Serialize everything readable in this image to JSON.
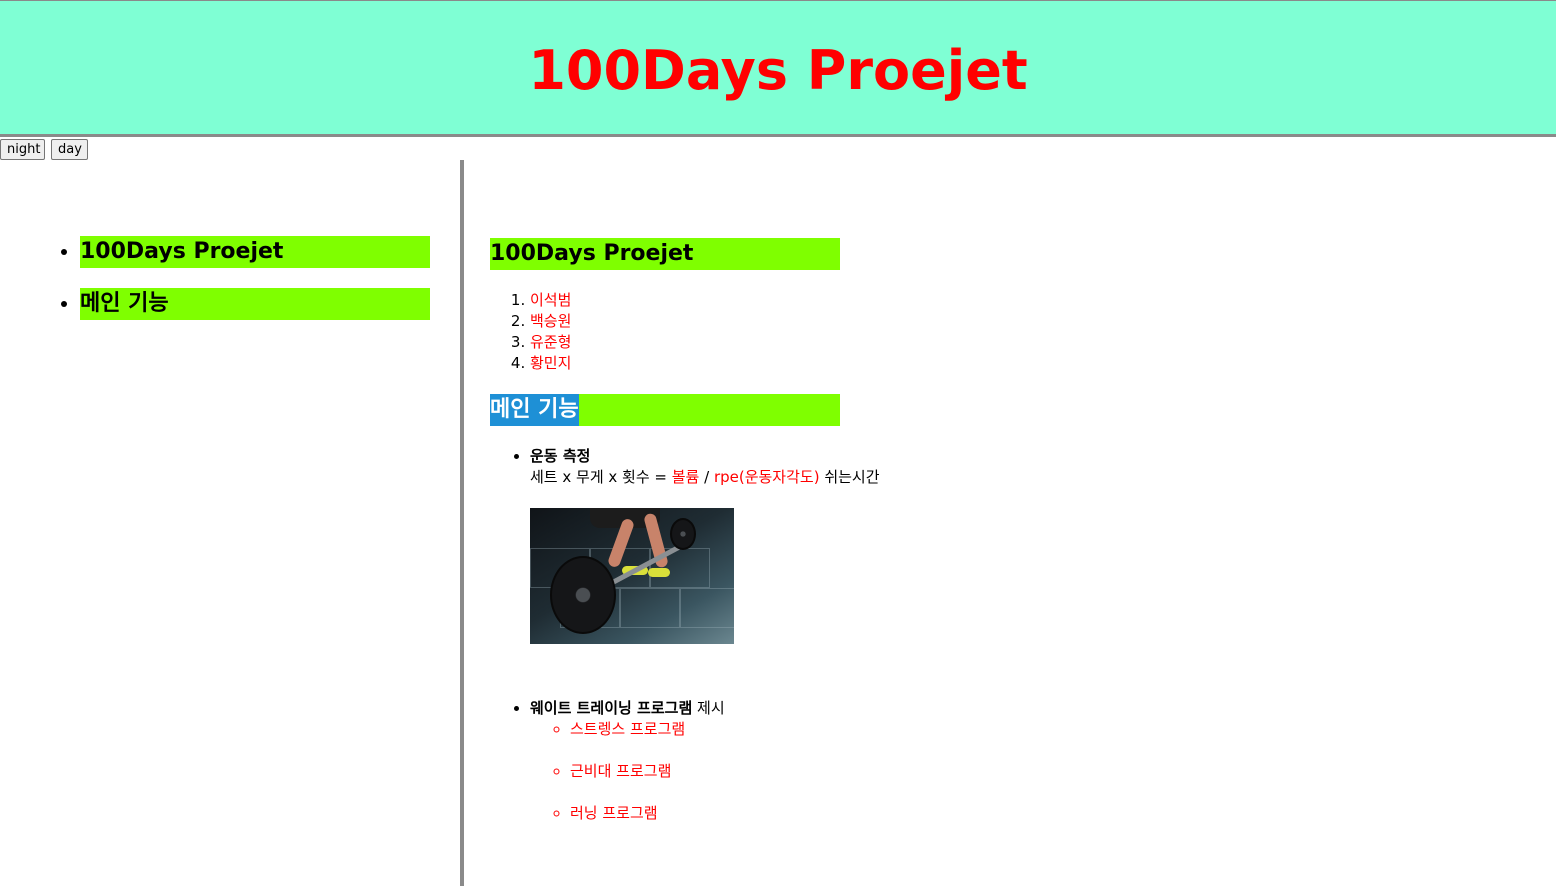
{
  "header": {
    "title": "100Days Proejet"
  },
  "mode_buttons": {
    "night_label": "night",
    "day_label": "day"
  },
  "sidebar": {
    "items": [
      {
        "label": "100Days Proejet"
      },
      {
        "label": "메인 기능"
      }
    ]
  },
  "main": {
    "project_heading": "100Days Proejet",
    "members": [
      "이석범",
      "백승원",
      "유준형",
      "황민지"
    ],
    "main_heading": "메인 기능",
    "features": {
      "exercise": {
        "title": "운동 측정",
        "formula_prefix": "세트 x 무게 x 횟수 = ",
        "volume": "볼륨",
        "slash": " / ",
        "rpe": "rpe(운동자각도)",
        "rest": " 쉬는시간",
        "image_alt": "barbell deadlift photo"
      },
      "program": {
        "title": "웨이트 트레이닝 프로그램",
        "suffix": " 제시",
        "items": [
          "스트렝스 프로그램",
          "근비대 프로그램",
          "러닝 프로그램"
        ]
      }
    }
  },
  "colors": {
    "header_bg": "#7fffd4",
    "title_red": "#ff0000",
    "heading_bg": "#7fff00",
    "selection_bg": "#1e90d6"
  }
}
